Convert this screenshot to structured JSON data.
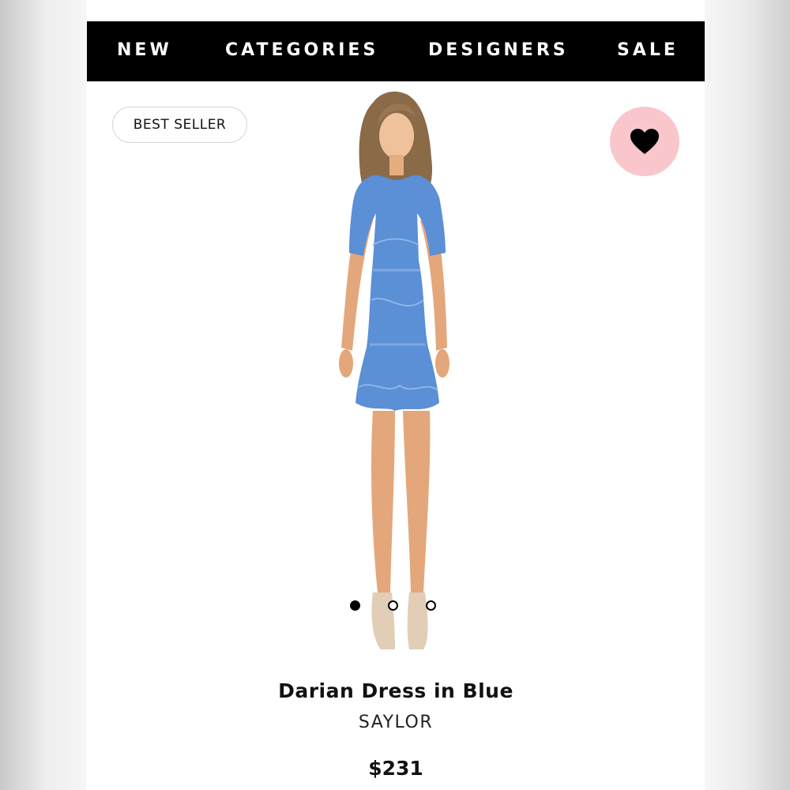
{
  "nav": {
    "items": [
      "NEW",
      "CATEGORIES",
      "DESIGNERS",
      "SALE"
    ]
  },
  "badge": {
    "label": "BEST SELLER"
  },
  "favorite": {
    "icon": "heart-icon",
    "bg_color": "#f9c6cb"
  },
  "product": {
    "title": "Darian Dress in Blue",
    "brand": "SAYLOR",
    "price": "$231",
    "dress_color": "#5b8fd6"
  },
  "carousel": {
    "count": 3,
    "active_index": 0
  }
}
